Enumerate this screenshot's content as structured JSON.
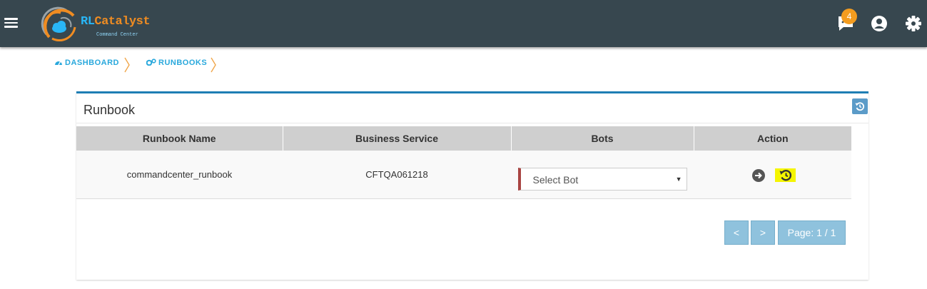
{
  "header": {
    "logo_brand_rl": "RL",
    "logo_brand_catalyst": "Catalyst",
    "logo_tagline": "Command Center",
    "notification_count": "4",
    "icons": [
      "menu-icon",
      "chat-icon",
      "user-icon",
      "gear-icon"
    ]
  },
  "breadcrumb": {
    "items": [
      {
        "label": "DASHBOARD",
        "icon": "dashboard-icon"
      },
      {
        "label": "RUNBOOKS",
        "icon": "cogs-icon"
      }
    ]
  },
  "panel": {
    "title": "Runbook",
    "columns": [
      "Runbook Name",
      "Business Service",
      "Bots",
      "Action"
    ],
    "rows": [
      {
        "runbook_name": "commandcenter_runbook",
        "business_service": "CFTQA061218",
        "bots_select": "Select Bot"
      }
    ]
  },
  "pagination": {
    "prev": "<",
    "next": ">",
    "page": "Page: 1 / 1"
  },
  "colors": {
    "topbar": "#37474f",
    "accent": "#29a8dc",
    "panel_border": "#1e7eb4",
    "badge": "#f39c1f",
    "highlight": "#f5f500"
  }
}
